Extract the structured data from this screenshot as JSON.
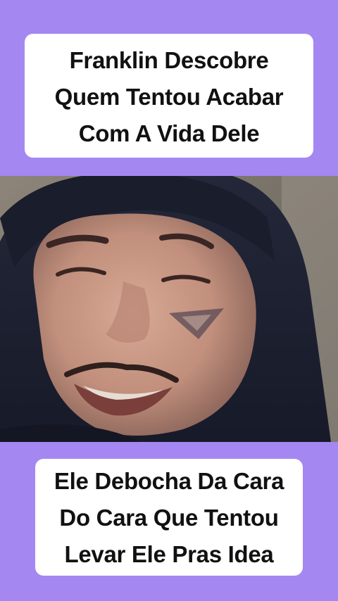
{
  "top_caption": {
    "lines": [
      "Franklin Descobre",
      "Quem Tentou Acabar",
      "Com A Vida Dele"
    ]
  },
  "bottom_caption": {
    "lines": [
      "Ele Debocha Da Cara",
      "Do Cara Que Tentou",
      "Levar Ele Pras Idea"
    ]
  },
  "colors": {
    "background": "#a587f2",
    "caption_bg": "#ffffff",
    "caption_text": "#111111"
  }
}
